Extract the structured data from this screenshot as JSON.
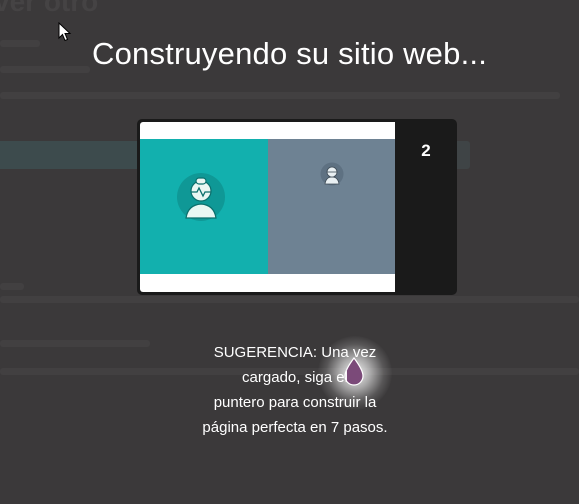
{
  "background_page": {
    "heading_fragment": "ver otro"
  },
  "overlay": {
    "title": "Construyendo su sitio web...",
    "preview": {
      "step_number": "2",
      "teal_color": "#12b0ae",
      "gray_color": "#6e8293",
      "frame_color": "#1a1a1a"
    },
    "tip": {
      "line1": "SUGERENCIA: Una vez",
      "line2": "cargado, siga el",
      "line3": "puntero para construir la",
      "line4": "página perfecta en 7 pasos."
    }
  },
  "icons": {
    "cursor": "mouse-pointer-icon",
    "avatar_large": "avatar-icon",
    "avatar_small": "avatar-icon",
    "pointer_drop": "pointer-drop-icon"
  },
  "colors": {
    "overlay_bg": "#3b393a",
    "drop_fill": "#7b4a79"
  }
}
